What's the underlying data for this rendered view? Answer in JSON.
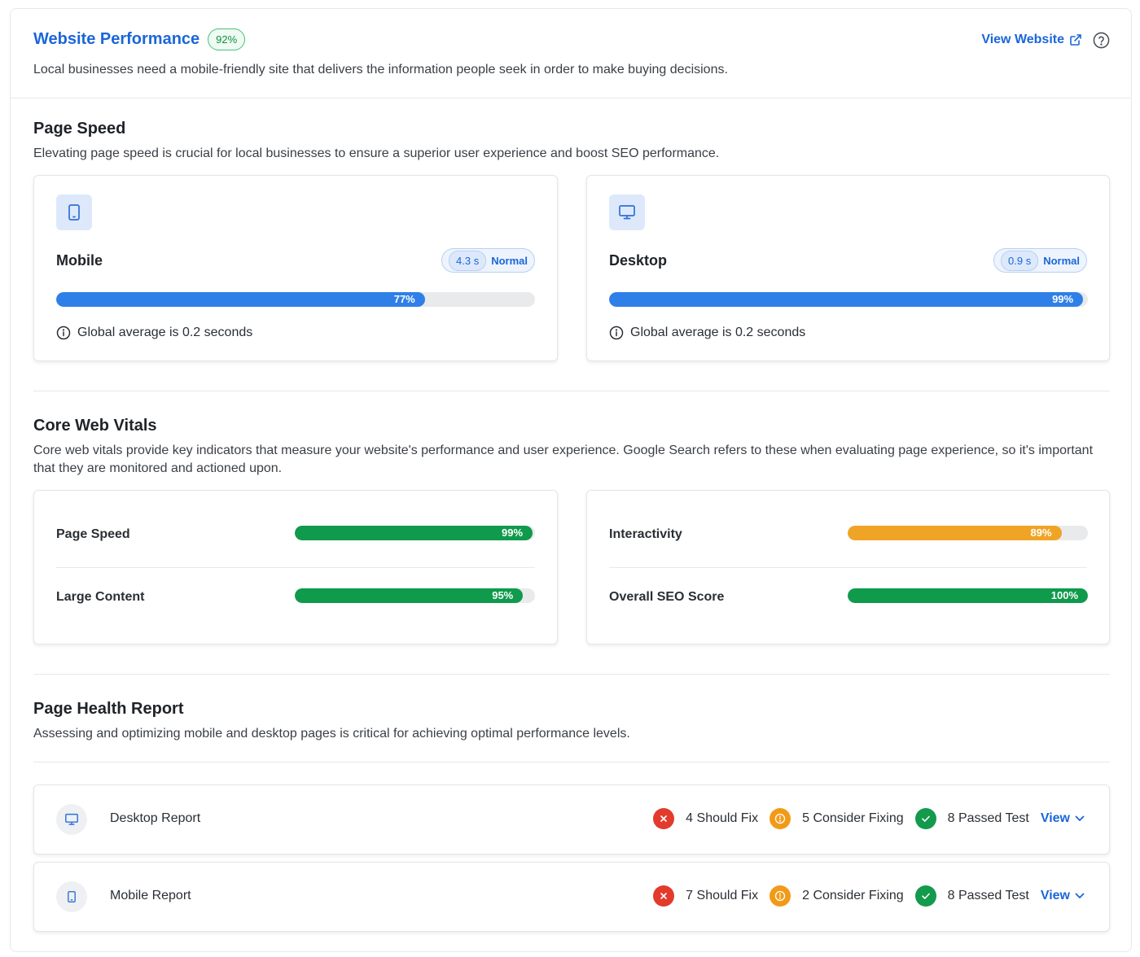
{
  "header": {
    "title": "Website Performance",
    "score": "92%",
    "subtitle": "Local businesses need a mobile-friendly site that delivers the information people seek in order to make buying decisions.",
    "view_website": "View Website"
  },
  "page_speed": {
    "title": "Page Speed",
    "description": "Elevating page speed is crucial for local businesses to ensure a superior user experience and boost SEO performance.",
    "cards": [
      {
        "name": "Mobile",
        "time": "4.3 s",
        "status": "Normal",
        "percent": 77,
        "percent_label": "77%",
        "note": "Global average is 0.2 seconds"
      },
      {
        "name": "Desktop",
        "time": "0.9 s",
        "status": "Normal",
        "percent": 99,
        "percent_label": "99%",
        "note": "Global average is 0.2 seconds"
      }
    ]
  },
  "core_web_vitals": {
    "title": "Core Web Vitals",
    "description": "Core web vitals provide key indicators that measure your website's performance and user experience. Google Search refers to these when evaluating page experience, so it's important that they are monitored and actioned upon.",
    "metrics": [
      {
        "label": "Page Speed",
        "percent": 99,
        "percent_label": "99%",
        "color": "#0f9a4c"
      },
      {
        "label": "Large Content",
        "percent": 95,
        "percent_label": "95%",
        "color": "#0f9a4c"
      },
      {
        "label": "Interactivity",
        "percent": 89,
        "percent_label": "89%",
        "color": "#f0a426"
      },
      {
        "label": "Overall SEO Score",
        "percent": 100,
        "percent_label": "100%",
        "color": "#0f9a4c"
      }
    ]
  },
  "page_health": {
    "title": "Page Health Report",
    "description": "Assessing and optimizing mobile and desktop pages is critical for achieving optimal performance levels.",
    "reports": [
      {
        "name": "Desktop Report",
        "should_fix": "4 Should Fix",
        "consider_fixing": "5 Consider Fixing",
        "passed": "8 Passed Test",
        "view": "View"
      },
      {
        "name": "Mobile Report",
        "should_fix": "7 Should Fix",
        "consider_fixing": "2 Consider Fixing",
        "passed": "8 Passed Test",
        "view": "View"
      }
    ]
  },
  "colors": {
    "accent": "#1a66d9",
    "speed_bar": "#2f7fe8",
    "good": "#0f9a4c",
    "warning": "#f0a426",
    "error": "#e23b2e"
  }
}
